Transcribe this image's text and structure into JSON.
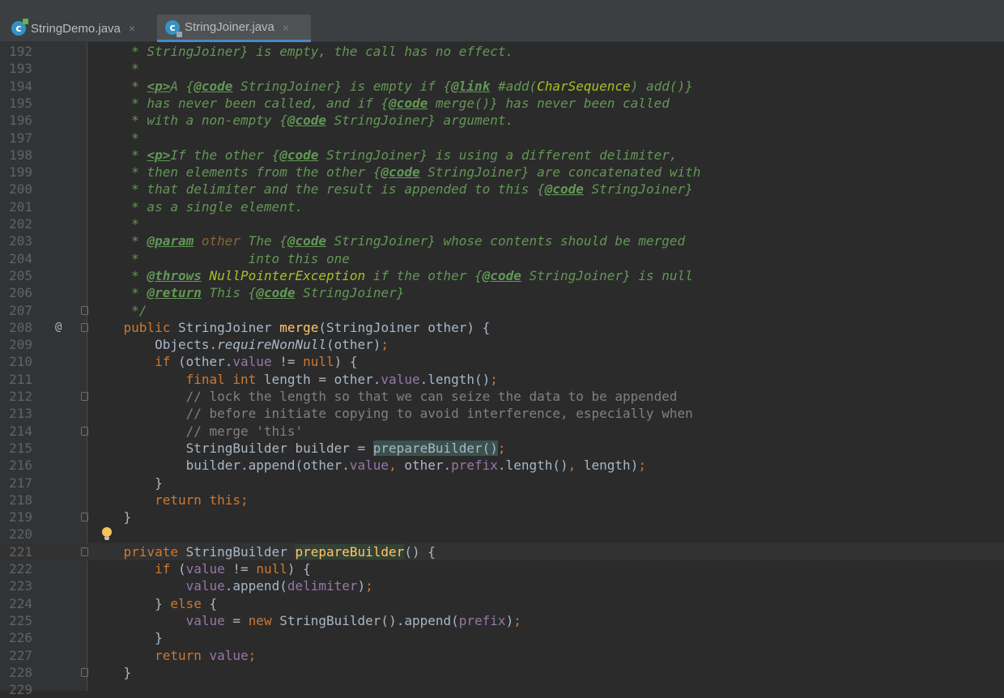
{
  "tabs": [
    {
      "name": "StringDemo.java",
      "icon": "java-class-icon",
      "close": "×",
      "active": false
    },
    {
      "name": "StringJoiner.java",
      "icon": "java-class-readonly-icon",
      "close": "×",
      "active": true
    }
  ],
  "editor": {
    "current_line": 221,
    "lines": [
      {
        "n": "192",
        "code": [
          {
            "c": "jd",
            "t": "     * StringJoiner} is empty, the call has no effect."
          }
        ]
      },
      {
        "n": "193",
        "code": [
          {
            "c": "jd",
            "t": "     *"
          }
        ]
      },
      {
        "n": "194",
        "code": [
          {
            "c": "jd",
            "t": "     * "
          },
          {
            "c": "jt",
            "t": "<p>"
          },
          {
            "c": "jd",
            "t": "A {"
          },
          {
            "c": "jt",
            "t": "@code"
          },
          {
            "c": "jd",
            "t": " StringJoiner} is empty if {"
          },
          {
            "c": "jt",
            "t": "@link"
          },
          {
            "c": "jd",
            "t": " #add("
          },
          {
            "c": "jref",
            "t": "CharSequence"
          },
          {
            "c": "jd",
            "t": ") add()}"
          }
        ]
      },
      {
        "n": "195",
        "code": [
          {
            "c": "jd",
            "t": "     * has never been called, and if {"
          },
          {
            "c": "jt",
            "t": "@code"
          },
          {
            "c": "jd",
            "t": " merge()} has never been called"
          }
        ]
      },
      {
        "n": "196",
        "code": [
          {
            "c": "jd",
            "t": "     * with a non-empty {"
          },
          {
            "c": "jt",
            "t": "@code"
          },
          {
            "c": "jd",
            "t": " StringJoiner} argument."
          }
        ]
      },
      {
        "n": "197",
        "code": [
          {
            "c": "jd",
            "t": "     *"
          }
        ]
      },
      {
        "n": "198",
        "code": [
          {
            "c": "jd",
            "t": "     * "
          },
          {
            "c": "jt",
            "t": "<p>"
          },
          {
            "c": "jd",
            "t": "If the other {"
          },
          {
            "c": "jt",
            "t": "@code"
          },
          {
            "c": "jd",
            "t": " StringJoiner} is using a different delimiter,"
          }
        ]
      },
      {
        "n": "199",
        "code": [
          {
            "c": "jd",
            "t": "     * then elements from the other {"
          },
          {
            "c": "jt",
            "t": "@code"
          },
          {
            "c": "jd",
            "t": " StringJoiner} are concatenated with"
          }
        ]
      },
      {
        "n": "200",
        "code": [
          {
            "c": "jd",
            "t": "     * that delimiter and the result is appended to this {"
          },
          {
            "c": "jt",
            "t": "@code"
          },
          {
            "c": "jd",
            "t": " StringJoiner}"
          }
        ]
      },
      {
        "n": "201",
        "code": [
          {
            "c": "jd",
            "t": "     * as a single element."
          }
        ]
      },
      {
        "n": "202",
        "code": [
          {
            "c": "jd",
            "t": "     *"
          }
        ]
      },
      {
        "n": "203",
        "code": [
          {
            "c": "jd",
            "t": "     * "
          },
          {
            "c": "jt",
            "t": "@param"
          },
          {
            "c": "jd",
            "t": " "
          },
          {
            "c": "jp",
            "t": "other"
          },
          {
            "c": "jd",
            "t": " The {"
          },
          {
            "c": "jt",
            "t": "@code"
          },
          {
            "c": "jd",
            "t": " StringJoiner} whose contents should be merged"
          }
        ]
      },
      {
        "n": "204",
        "code": [
          {
            "c": "jd",
            "t": "     *              into this one"
          }
        ]
      },
      {
        "n": "205",
        "code": [
          {
            "c": "jd",
            "t": "     * "
          },
          {
            "c": "jt",
            "t": "@throws"
          },
          {
            "c": "jd",
            "t": " "
          },
          {
            "c": "jref",
            "t": "NullPointerException"
          },
          {
            "c": "jd",
            "t": " if the other {"
          },
          {
            "c": "jt",
            "t": "@code"
          },
          {
            "c": "jd",
            "t": " StringJoiner} is null"
          }
        ]
      },
      {
        "n": "206",
        "code": [
          {
            "c": "jd",
            "t": "     * "
          },
          {
            "c": "jt",
            "t": "@return"
          },
          {
            "c": "jd",
            "t": " This {"
          },
          {
            "c": "jt",
            "t": "@code"
          },
          {
            "c": "jd",
            "t": " StringJoiner}"
          }
        ]
      },
      {
        "n": "207",
        "fold": true,
        "code": [
          {
            "c": "jd",
            "t": "     */"
          }
        ]
      },
      {
        "n": "208",
        "marker": "@",
        "fold": true,
        "code": [
          {
            "c": "kw",
            "t": "    public "
          },
          {
            "c": "",
            "t": "StringJoiner "
          },
          {
            "c": "fn",
            "t": "merge"
          },
          {
            "c": "",
            "t": "(StringJoiner other) {"
          }
        ]
      },
      {
        "n": "209",
        "code": [
          {
            "c": "",
            "t": "        Objects."
          },
          {
            "c": "it",
            "t": "requireNonNull"
          },
          {
            "c": "",
            "t": "(other)"
          },
          {
            "c": "kw",
            "t": ";"
          }
        ]
      },
      {
        "n": "210",
        "code": [
          {
            "c": "kw",
            "t": "        if "
          },
          {
            "c": "",
            "t": "(other."
          },
          {
            "c": "fld",
            "t": "value"
          },
          {
            "c": "",
            "t": " != "
          },
          {
            "c": "kw",
            "t": "null"
          },
          {
            "c": "",
            "t": ") {"
          }
        ]
      },
      {
        "n": "211",
        "code": [
          {
            "c": "kw",
            "t": "            final int "
          },
          {
            "c": "",
            "t": "length = other."
          },
          {
            "c": "fld",
            "t": "value"
          },
          {
            "c": "",
            "t": ".length()"
          },
          {
            "c": "kw",
            "t": ";"
          }
        ]
      },
      {
        "n": "212",
        "fold": true,
        "code": [
          {
            "c": "cm",
            "t": "            // lock the length so that we can seize the data to be appended"
          }
        ]
      },
      {
        "n": "213",
        "code": [
          {
            "c": "cm",
            "t": "            // before initiate copying to avoid interference, especially when"
          }
        ]
      },
      {
        "n": "214",
        "fold": true,
        "code": [
          {
            "c": "cm",
            "t": "            // merge 'this'"
          }
        ]
      },
      {
        "n": "215",
        "code": [
          {
            "c": "",
            "t": "            StringBuilder builder = "
          },
          {
            "c": "callhl",
            "t": "prepareBuilder()"
          },
          {
            "c": "kw",
            "t": ";"
          }
        ]
      },
      {
        "n": "216",
        "code": [
          {
            "c": "",
            "t": "            builder.append(other."
          },
          {
            "c": "fld",
            "t": "value"
          },
          {
            "c": "kw",
            "t": ", "
          },
          {
            "c": "",
            "t": "other."
          },
          {
            "c": "fld",
            "t": "prefix"
          },
          {
            "c": "",
            "t": ".length()"
          },
          {
            "c": "kw",
            "t": ", "
          },
          {
            "c": "",
            "t": "length)"
          },
          {
            "c": "kw",
            "t": ";"
          }
        ]
      },
      {
        "n": "217",
        "code": [
          {
            "c": "",
            "t": "        }"
          }
        ]
      },
      {
        "n": "218",
        "code": [
          {
            "c": "kw",
            "t": "        return this;"
          }
        ]
      },
      {
        "n": "219",
        "fold": true,
        "code": [
          {
            "c": "",
            "t": "    }"
          }
        ]
      },
      {
        "n": "220",
        "bulb": true,
        "code": [
          {
            "c": "",
            "t": ""
          }
        ]
      },
      {
        "n": "221",
        "fold": true,
        "code": [
          {
            "c": "kw",
            "t": "    private "
          },
          {
            "c": "",
            "t": "StringBuilder "
          },
          {
            "c": "fn usage",
            "t": "prepareBuilder"
          },
          {
            "c": "",
            "t": "() {"
          }
        ]
      },
      {
        "n": "222",
        "code": [
          {
            "c": "kw",
            "t": "        if "
          },
          {
            "c": "",
            "t": "("
          },
          {
            "c": "fld",
            "t": "value"
          },
          {
            "c": "",
            "t": " != "
          },
          {
            "c": "kw",
            "t": "null"
          },
          {
            "c": "",
            "t": ") {"
          }
        ]
      },
      {
        "n": "223",
        "code": [
          {
            "c": "fld",
            "t": "            value"
          },
          {
            "c": "",
            "t": ".append("
          },
          {
            "c": "fld",
            "t": "delimiter"
          },
          {
            "c": "",
            "t": ")"
          },
          {
            "c": "kw",
            "t": ";"
          }
        ]
      },
      {
        "n": "224",
        "code": [
          {
            "c": "",
            "t": "        } "
          },
          {
            "c": "kw",
            "t": "else "
          },
          {
            "c": "",
            "t": "{"
          }
        ]
      },
      {
        "n": "225",
        "code": [
          {
            "c": "fld",
            "t": "            value"
          },
          {
            "c": "",
            "t": " = "
          },
          {
            "c": "kw",
            "t": "new "
          },
          {
            "c": "",
            "t": "StringBuilder().append("
          },
          {
            "c": "fld",
            "t": "prefix"
          },
          {
            "c": "",
            "t": ")"
          },
          {
            "c": "kw",
            "t": ";"
          }
        ]
      },
      {
        "n": "226",
        "code": [
          {
            "c": "",
            "t": "        }"
          }
        ]
      },
      {
        "n": "227",
        "code": [
          {
            "c": "kw",
            "t": "        return "
          },
          {
            "c": "fld",
            "t": "value"
          },
          {
            "c": "kw",
            "t": ";"
          }
        ]
      },
      {
        "n": "228",
        "fold": true,
        "code": [
          {
            "c": "",
            "t": "    }"
          }
        ]
      },
      {
        "n": "229",
        "code": [
          {
            "c": "",
            "t": ""
          }
        ]
      }
    ]
  }
}
